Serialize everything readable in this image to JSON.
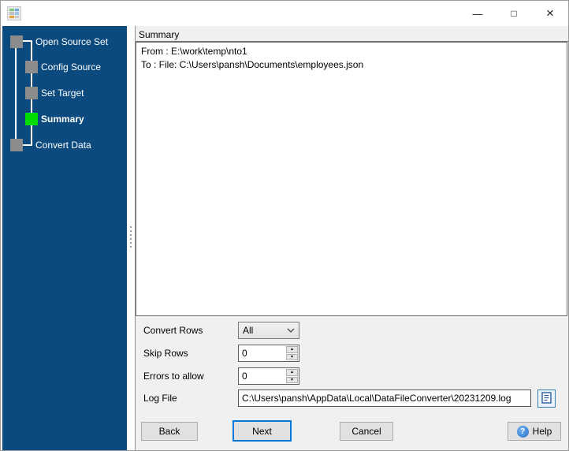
{
  "window": {
    "controls": {
      "minimize": "—",
      "maximize": "□",
      "close": "×"
    }
  },
  "icons": {
    "app_icon": "colored-grid-converter",
    "minimize": "—",
    "maximize": "□",
    "close": "×",
    "chevron_down": "v-shape",
    "spinner_up": "▴",
    "spinner_down": "▾",
    "help_question": "?",
    "log_document": "blue-document"
  },
  "sidebar": {
    "steps": [
      {
        "label": "Open Source Set",
        "state": "done"
      },
      {
        "label": "Config Source",
        "state": "done"
      },
      {
        "label": "Set Target",
        "state": "done"
      },
      {
        "label": "Summary",
        "state": "active"
      },
      {
        "label": "Convert Data",
        "state": "pending"
      }
    ]
  },
  "main": {
    "header": "Summary",
    "summary_lines": [
      "From : E:\\work\\temp\\nto1",
      "To : File: C:\\Users\\pansh\\Documents\\employees.json"
    ],
    "form": {
      "convert_rows": {
        "label": "Convert Rows",
        "value": "All"
      },
      "skip_rows": {
        "label": "Skip Rows",
        "value": "0"
      },
      "errors_to_allow": {
        "label": "Errors to allow",
        "value": "0"
      },
      "log_file": {
        "label": "Log File",
        "value": "C:\\Users\\pansh\\AppData\\Local\\DataFileConverter\\20231209.log"
      }
    },
    "buttons": {
      "back": "Back",
      "next": "Next",
      "cancel": "Cancel",
      "help": "Help"
    }
  },
  "colors": {
    "sidebar_bg": "#0B4A7E",
    "step_done": "#8C8C8C",
    "step_active": "#00DD00",
    "panel_bg": "#F0F0F0",
    "accent_focus": "#0078D7",
    "button_bg": "#E1E1E1"
  }
}
